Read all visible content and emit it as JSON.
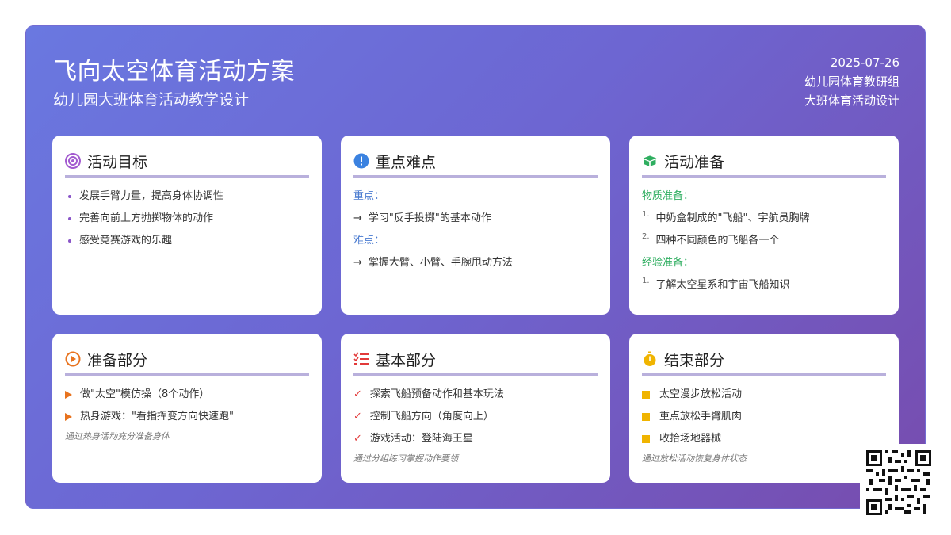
{
  "header": {
    "title": "飞向太空体育活动方案",
    "subtitle": "幼儿园大班体育活动教学设计",
    "date": "2025-07-26",
    "org": "幼儿园体育教研组",
    "design": "大班体育活动设计"
  },
  "goals": {
    "title": "活动目标",
    "items": [
      "发展手臂力量，提高身体协调性",
      "完善向前上方抛掷物体的动作",
      "感受竞赛游戏的乐趣"
    ]
  },
  "keypoints": {
    "title": "重点难点",
    "key_label": "重点：",
    "key_item": "学习\"反手投掷\"的基本动作",
    "hard_label": "难点：",
    "hard_item": "掌握大臂、小臂、手腕甩动方法"
  },
  "prep": {
    "title": "活动准备",
    "material_label": "物质准备：",
    "material_items": [
      "中奶盒制成的\"飞船\"、宇航员胸牌",
      "四种不同颜色的飞船各一个"
    ],
    "exp_label": "经验准备：",
    "exp_items": [
      "了解太空星系和宇宙飞船知识"
    ],
    "nums": [
      "1.",
      "2.",
      "1."
    ]
  },
  "warmup": {
    "title": "准备部分",
    "items": [
      "做\"太空\"模仿操（8个动作）",
      "热身游戏：\"看指挥变方向快速跑\""
    ],
    "note": "通过热身活动充分准备身体"
  },
  "basic": {
    "title": "基本部分",
    "items": [
      "探索飞船预备动作和基本玩法",
      "控制飞船方向（角度向上）",
      "游戏活动：登陆海王星"
    ],
    "note": "通过分组练习掌握动作要领"
  },
  "ending": {
    "title": "结束部分",
    "items": [
      "太空漫步放松活动",
      "重点放松手臂肌肉",
      "收拾场地器械"
    ],
    "note": "通过放松活动恢复身体状态"
  },
  "icons": [
    "target-icon",
    "exclamation-icon",
    "box-icon",
    "play-icon",
    "checklist-icon",
    "stopwatch-icon",
    "qr-code-icon"
  ],
  "colors": {
    "gradient_start": "#6a78e0",
    "gradient_end": "#774cae",
    "purple": "#8a55c8",
    "blue": "#4a7bd0",
    "green": "#2fae60",
    "orange": "#e8731f",
    "red": "#e23a3a",
    "gold": "#f0b400"
  }
}
